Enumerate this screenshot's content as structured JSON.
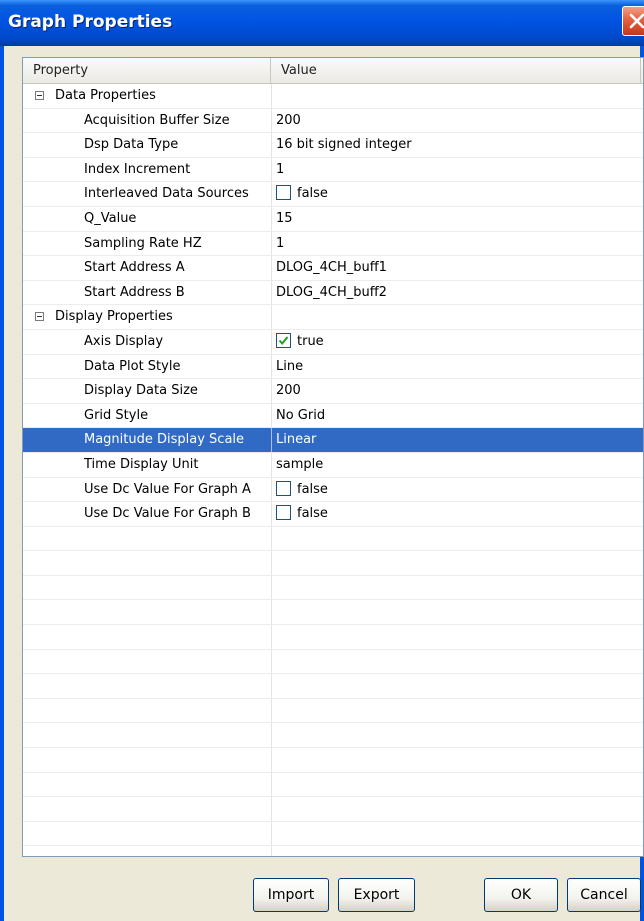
{
  "window": {
    "title": "Graph Properties",
    "close_icon": "close-icon"
  },
  "grid": {
    "columns": [
      "Property",
      "Value"
    ],
    "rows": [
      {
        "kind": "category",
        "name": "Data Properties",
        "value": "",
        "expanded": true
      },
      {
        "kind": "property",
        "name": "Acquisition Buffer Size",
        "value": "200"
      },
      {
        "kind": "property",
        "name": "Dsp Data Type",
        "value": "16 bit signed integer"
      },
      {
        "kind": "property",
        "name": "Index Increment",
        "value": "1"
      },
      {
        "kind": "property",
        "name": "Interleaved Data Sources",
        "value": "false",
        "checkbox": true,
        "checked": false
      },
      {
        "kind": "property",
        "name": "Q_Value",
        "value": "15"
      },
      {
        "kind": "property",
        "name": "Sampling Rate HZ",
        "value": "1"
      },
      {
        "kind": "property",
        "name": "Start Address A",
        "value": "DLOG_4CH_buff1"
      },
      {
        "kind": "property",
        "name": "Start Address B",
        "value": "DLOG_4CH_buff2"
      },
      {
        "kind": "category",
        "name": "Display Properties",
        "value": "",
        "expanded": true
      },
      {
        "kind": "property",
        "name": "Axis Display",
        "value": "true",
        "checkbox": true,
        "checked": true
      },
      {
        "kind": "property",
        "name": "Data Plot Style",
        "value": "Line"
      },
      {
        "kind": "property",
        "name": "Display Data Size",
        "value": "200"
      },
      {
        "kind": "property",
        "name": "Grid Style",
        "value": "No Grid"
      },
      {
        "kind": "property",
        "name": "Magnitude Display Scale",
        "value": "Linear",
        "selected": true
      },
      {
        "kind": "property",
        "name": "Time Display Unit",
        "value": "sample"
      },
      {
        "kind": "property",
        "name": "Use Dc Value For Graph A",
        "value": "false",
        "checkbox": true,
        "checked": false
      },
      {
        "kind": "property",
        "name": "Use Dc Value For Graph B",
        "value": "false",
        "checkbox": true,
        "checked": false
      }
    ],
    "selection_color": "#316ac5"
  },
  "buttons": {
    "import": "Import",
    "export": "Export",
    "ok": "OK",
    "cancel": "Cancel"
  },
  "colors": {
    "titlebar": "#0054e3",
    "dialog_bg": "#ece9d8",
    "close_button": "#e4603e"
  }
}
